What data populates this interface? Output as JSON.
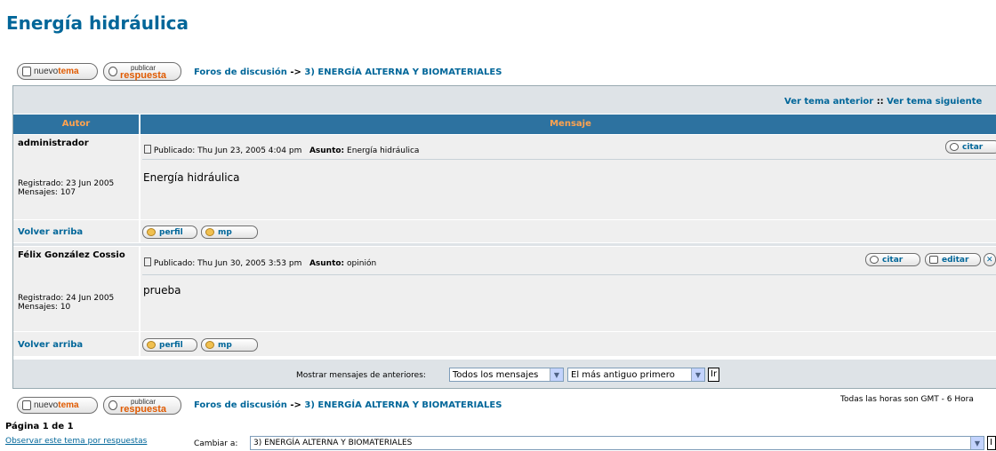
{
  "page_title": "Energía hidráulica",
  "buttons": {
    "new_topic_1": "nuevo",
    "new_topic_2": "tema",
    "reply_1": "publicar",
    "reply_2": "respuesta"
  },
  "breadcrumb": {
    "forums": "Foros de discusión",
    "sep": "->",
    "forum": "3) ENERGÍA ALTERNA Y BIOMATERIALES"
  },
  "topic_nav": {
    "prev": "Ver tema anterior",
    "sep": "::",
    "next": "Ver tema siguiente"
  },
  "table_headers": {
    "author": "Autor",
    "message": "Mensaje"
  },
  "posts": [
    {
      "author": "administrador",
      "published_label": "Publicado:",
      "published": "Thu Jun 23, 2005 4:04 pm",
      "subject_label": "Asunto:",
      "subject": "Energía hidráulica",
      "registered": "Registrado: 23 Jun 2005",
      "posts_count": "Mensajes: 107",
      "body": "Energía hidráulica",
      "back_top": "Volver arriba",
      "profile": "perfil",
      "pm": "mp",
      "quote": "citar"
    },
    {
      "author": "Félix González Cossio",
      "published_label": "Publicado:",
      "published": "Thu Jun 30, 2005 3:53 pm",
      "subject_label": "Asunto:",
      "subject": "opinión",
      "registered": "Registrado: 24 Jun 2005",
      "posts_count": "Mensajes: 10",
      "body": "prueba",
      "back_top": "Volver arriba",
      "profile": "perfil",
      "pm": "mp",
      "quote": "citar",
      "edit": "editar"
    }
  ],
  "filter": {
    "label": "Mostrar mensajes de anteriores:",
    "period": "Todos los mensajes",
    "order": "El más antiguo primero",
    "go": "Ir"
  },
  "timezone_note": "Todas las horas son GMT - 6 Hora",
  "pagination": "Página 1 de 1",
  "watch_topic": "Observar este tema por respuestas",
  "jump": {
    "label": "Cambiar a:",
    "value": "3) ENERGÍA ALTERNA Y BIOMATERIALES",
    "go": "I"
  },
  "colors": {
    "link": "#006699",
    "header_bg": "#2d72a0",
    "header_text": "#ffa34f",
    "bar_bg": "#dee3e7",
    "row_bg": "#efefef"
  }
}
